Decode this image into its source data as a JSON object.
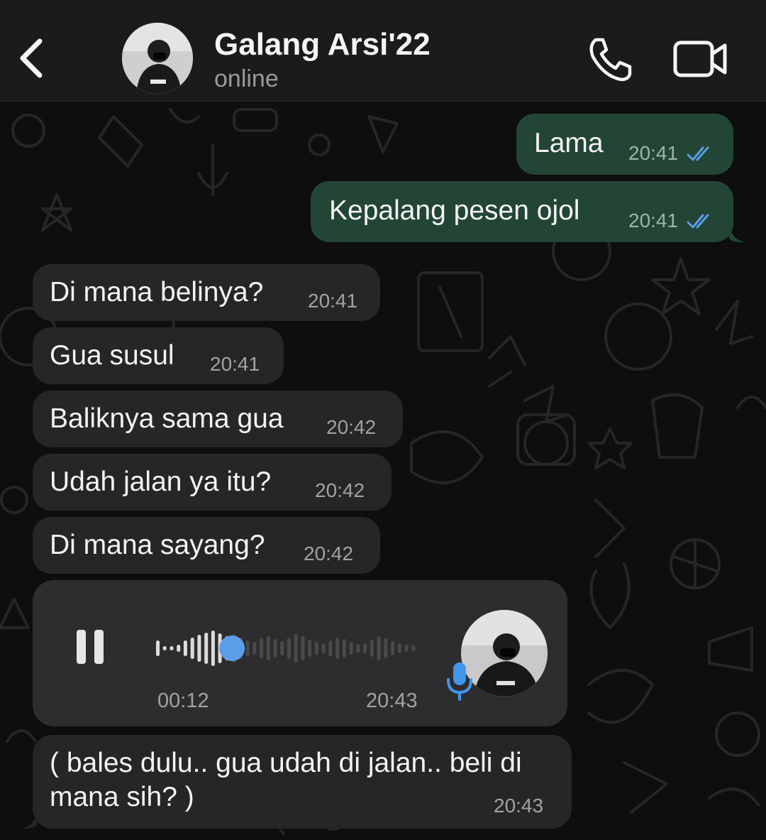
{
  "header": {
    "contact_name": "Galang Arsi'22",
    "status": "online",
    "back_icon": "chevron-left-icon",
    "call_icon": "phone-icon",
    "video_icon": "video-camera-icon"
  },
  "colors": {
    "outgoing_bubble": "#234536",
    "incoming_bubble": "#262626",
    "read_ticks": "#5b9ee8",
    "voice_accent": "#5b9ee8",
    "header_bg": "#1b1b1b"
  },
  "messages": [
    {
      "direction": "out",
      "text": "Lama",
      "time": "20:41",
      "status": "read"
    },
    {
      "direction": "out",
      "text": "Kepalang pesen ojol",
      "time": "20:41",
      "status": "read"
    },
    {
      "direction": "in",
      "text": "Di mana belinya?",
      "time": "20:41"
    },
    {
      "direction": "in",
      "text": "Gua susul",
      "time": "20:41"
    },
    {
      "direction": "in",
      "text": "Baliknya sama gua",
      "time": "20:42"
    },
    {
      "direction": "in",
      "text": "Udah jalan ya itu?",
      "time": "20:42"
    },
    {
      "direction": "in",
      "text": "Di mana sayang?",
      "time": "20:42"
    }
  ],
  "voice_note": {
    "duration": "00:12",
    "time": "20:43",
    "state": "playing",
    "progress": 0.3,
    "pause_icon": "pause-icon",
    "mic_icon": "microphone-icon"
  },
  "last_message": {
    "direction": "in",
    "text": "( bales dulu.. gua udah di jalan.. beli di mana sih? )",
    "time": "20:43"
  }
}
